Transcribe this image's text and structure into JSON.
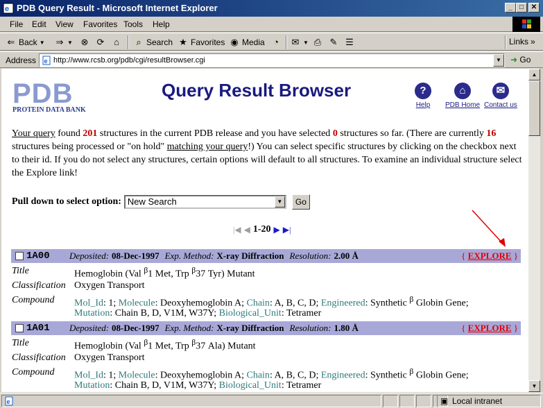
{
  "window": {
    "title": "PDB Query Result - Microsoft Internet Explorer"
  },
  "menu": [
    "File",
    "Edit",
    "View",
    "Favorites",
    "Tools",
    "Help"
  ],
  "toolbar": {
    "back": "Back",
    "search": "Search",
    "favorites": "Favorites",
    "media": "Media",
    "links": "Links"
  },
  "address": {
    "label": "Address",
    "url": "http://www.rcsb.org/pdb/cgi/resultBrowser.cgi",
    "go": "Go"
  },
  "header": {
    "logo": "PDB",
    "logo_sub": "PROTEIN DATA BANK",
    "title": "Query Result Browser",
    "help": "Help",
    "home": "PDB Home",
    "contact": "Contact us"
  },
  "intro": {
    "your_query": "Your query",
    "t1": " found ",
    "found": "201",
    "t2": " structures in the current PDB release and you have selected ",
    "selected": "0",
    "t3": " structures so far. (There are currently ",
    "processing": "16",
    "t4": " structures being processed or \"on hold\" ",
    "matching": "matching your query",
    "t5": "!) You can select specific structures by clicking on the checkbox next to their id. If you do not select any structures, certain options will default to all structures. To examine an individual structure select the Explore link!"
  },
  "pulldown": {
    "label": "Pull down to select option:",
    "selected": "New Search",
    "go": "Go"
  },
  "pager": {
    "range": "1-20"
  },
  "labels": {
    "deposited": "Deposited:",
    "method": "Exp. Method:",
    "resolution": "Resolution:",
    "explore": "EXPLORE",
    "title": "Title",
    "classification": "Classification",
    "compound": "Compound",
    "mol_id": "Mol_Id",
    "molecule": "Molecule",
    "chain": "Chain",
    "engineered": "Engineered",
    "mutation": "Mutation",
    "bio_unit": "Biological_Unit"
  },
  "entries": [
    {
      "id": "1A00",
      "deposited": "08-Dec-1997",
      "method": "X-ray Diffraction",
      "resolution": "2.00 Å",
      "title_a": "Hemoglobin (Val ",
      "title_b": "1 Met, Trp ",
      "title_c": "37 Tyr) Mutant",
      "classification": "Oxygen Transport",
      "mol_id": "1",
      "molecule": "Deoxyhemoglobin A",
      "chain": "A, B, C, D",
      "engineered": "Synthetic ",
      "engineered_tail": " Globin Gene;",
      "mutation": "Chain B, D, V1M, W37Y",
      "bio_unit": "Tetramer"
    },
    {
      "id": "1A01",
      "deposited": "08-Dec-1997",
      "method": "X-ray Diffraction",
      "resolution": "1.80 Å",
      "title_a": "Hemoglobin (Val ",
      "title_b": "1 Met, Trp ",
      "title_c": "37 Ala) Mutant",
      "classification": "Oxygen Transport",
      "mol_id": "1",
      "molecule": "Deoxyhemoglobin A",
      "chain": "A, B, C, D",
      "engineered": "Synthetic ",
      "engineered_tail": " Globin Gene;",
      "mutation": "Chain B, D, V1M, W37Y",
      "bio_unit": "Tetramer"
    }
  ],
  "status": {
    "zone": "Local intranet"
  }
}
